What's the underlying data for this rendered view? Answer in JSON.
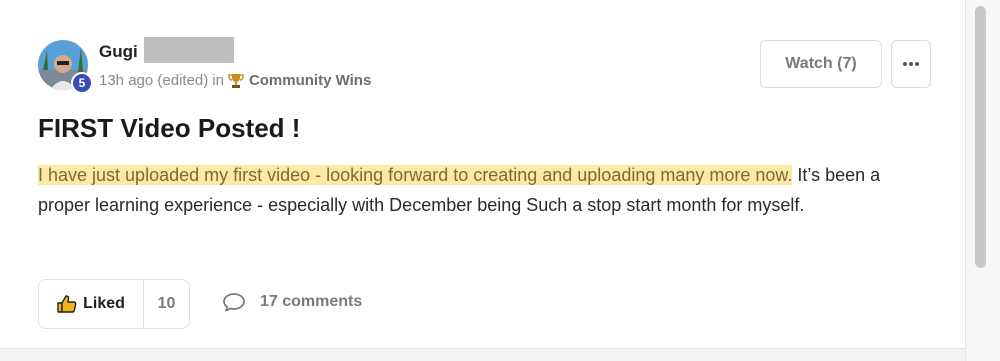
{
  "post": {
    "author": {
      "name": "Gugi",
      "level": "5"
    },
    "meta": {
      "time": "13h ago (edited)",
      "in_label": "in",
      "category": "Community Wins",
      "category_icon": "trophy-icon"
    },
    "actions": {
      "watch_label": "Watch (7)",
      "more_icon": "ellipsis-icon"
    },
    "title": "FIRST Video Posted !",
    "body": {
      "highlighted": "I have just uploaded my first video - looking forward to creating and uploading many more now.",
      "rest": " It’s been a proper learning experience - especially with December being Such a stop start month for myself."
    },
    "footer": {
      "like_label": "Liked",
      "like_count": "10",
      "comments_label": "17 comments"
    }
  },
  "colors": {
    "highlight": "#fde9a6",
    "level_badge": "#3b4cb3",
    "trophy": "#c8901a"
  }
}
